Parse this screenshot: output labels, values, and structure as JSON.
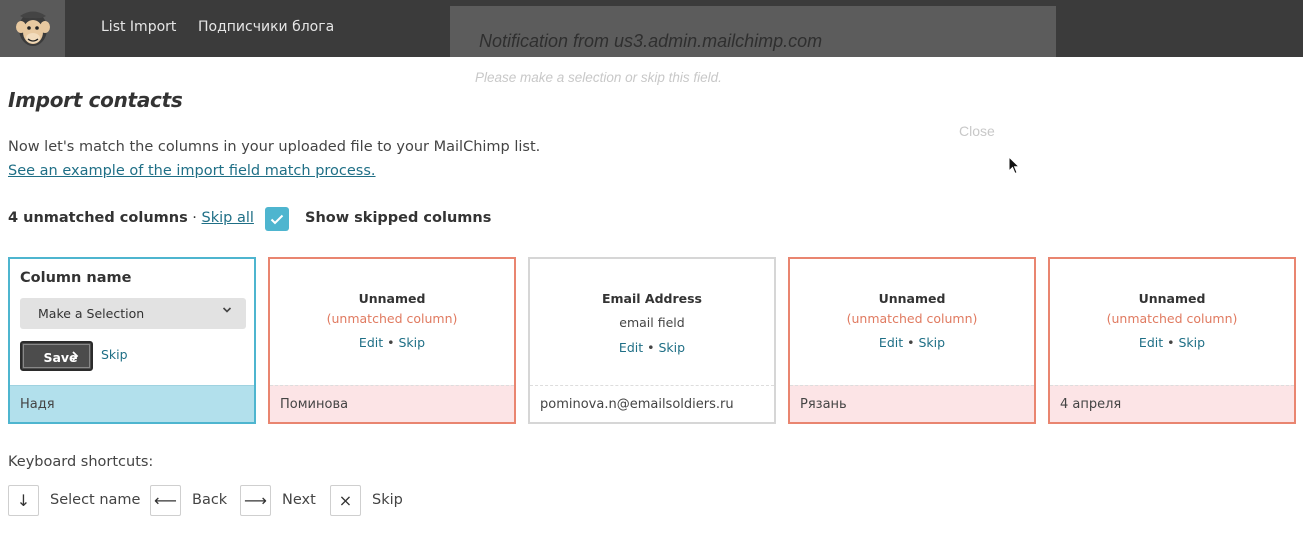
{
  "header": {
    "nav": [
      {
        "label": "List Import"
      },
      {
        "label": "Подписчики блога"
      }
    ]
  },
  "notification": {
    "title": "Notification from us3.admin.mailchimp.com",
    "message": "Please make a selection or skip this field.",
    "close_label": "Close"
  },
  "page": {
    "title": "Import contacts",
    "intro": "Now let's match the columns in your uploaded file to your MailChimp list.",
    "example_link": "See an example of the import field match process."
  },
  "status": {
    "unmatched": "4 unmatched columns",
    "separator": " · ",
    "skip_all": "Skip all",
    "show_skipped_label": "Show skipped columns",
    "show_skipped_checked": true
  },
  "active_column": {
    "title": "Column name",
    "select_value": "Make a Selection",
    "save_label": "Save",
    "skip_label": "Skip",
    "sample": "Надя"
  },
  "columns": [
    {
      "name": "Unnamed",
      "sub": "(unmatched column)",
      "edit": "Edit",
      "sep": " • ",
      "skip": "Skip",
      "sample": "Поминова"
    },
    {
      "name": "Email Address",
      "sub": "email field",
      "edit": "Edit",
      "sep": " • ",
      "skip": "Skip",
      "sample": "pominova.n@emailsoldiers.ru"
    },
    {
      "name": "Unnamed",
      "sub": "(unmatched column)",
      "edit": "Edit",
      "sep": " • ",
      "skip": "Skip",
      "sample": "Рязань"
    },
    {
      "name": "Unnamed",
      "sub": "(unmatched column)",
      "edit": "Edit",
      "sep": " • ",
      "skip": "Skip",
      "sample": "4 апреля"
    }
  ],
  "shortcuts": {
    "title": "Keyboard shortcuts:",
    "items": [
      {
        "key": "↓",
        "label": "Select name"
      },
      {
        "key": "⟵",
        "label": "Back"
      },
      {
        "key": "⟶",
        "label": "Next"
      },
      {
        "key": "×",
        "label": "Skip"
      }
    ]
  },
  "colors": {
    "topbar": "#3b3b3b",
    "accent_blue": "#4eb5cf",
    "unmatched_border": "#e98570",
    "link": "#1f6f86"
  }
}
